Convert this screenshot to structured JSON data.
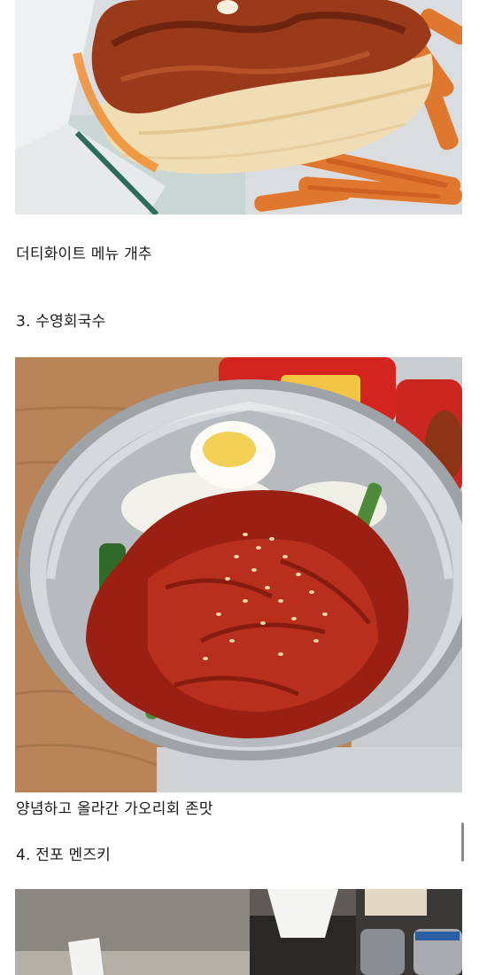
{
  "post": {
    "caption_1": "더티화이트 메뉴 개추",
    "heading_3": "3. 수영회국수",
    "caption_2": "양념하고 올라간 가오리회 존맛",
    "heading_4": "4. 전포 멘즈키"
  },
  "images": [
    {
      "subject": "chicken-sandwich-with-sweet-potato-fries"
    },
    {
      "subject": "spicy-raw-fish-noodles-in-steel-bowl"
    },
    {
      "subject": "restaurant-counter-with-tissue-box-and-condiments"
    }
  ]
}
